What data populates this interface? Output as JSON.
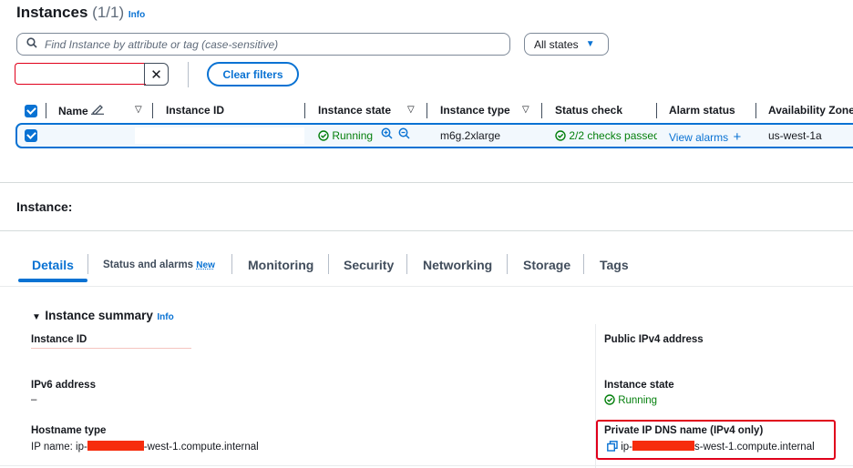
{
  "header": {
    "title": "Instances",
    "count": "(1/1)",
    "info": "Info"
  },
  "search": {
    "placeholder": "Find Instance by attribute or tag (case-sensitive)"
  },
  "states_filter": {
    "label": "All states"
  },
  "clear_filters": "Clear filters",
  "table": {
    "columns": [
      "Name",
      "Instance ID",
      "Instance state",
      "Instance type",
      "Status check",
      "Alarm status",
      "Availability Zone"
    ],
    "row": {
      "state": "Running",
      "type": "m6g.2xlarge",
      "status_check": "2/2 checks passed",
      "alarm": "View alarms",
      "zone": "us-west-1a"
    }
  },
  "panel": {
    "title": "Instance:",
    "tabs": [
      {
        "label": "Details",
        "selected": true
      },
      {
        "label": "Status and alarms",
        "badge": "New"
      },
      {
        "label": "Monitoring"
      },
      {
        "label": "Security"
      },
      {
        "label": "Networking"
      },
      {
        "label": "Storage"
      },
      {
        "label": "Tags"
      }
    ],
    "summary_title": "Instance summary",
    "summary_info": "Info",
    "fields": {
      "instance_id_label": "Instance ID",
      "ipv6_label": "IPv6 address",
      "ipv6_value": "–",
      "hostname_label": "Hostname type",
      "hostname_prefix": "IP name: ip-",
      "hostname_suffix": "-west-1.compute.internal",
      "public_ipv4_label": "Public IPv4 address",
      "instance_state_label": "Instance state",
      "instance_state_value": "Running",
      "private_dns_label": "Private IP DNS name (IPv4 only)",
      "private_dns_prefix": "ip-",
      "private_dns_suffix": "s-west-1.compute.internal"
    }
  },
  "colors": {
    "accent": "#0972d3",
    "success": "#037f0c",
    "highlight": "#e0001b"
  },
  "icons": [
    "search-icon",
    "caret-down-icon",
    "close-icon",
    "edit-icon",
    "filter-icon",
    "check-circle-icon",
    "zoom-in-icon",
    "zoom-out-icon",
    "plus-icon",
    "copy-icon"
  ]
}
